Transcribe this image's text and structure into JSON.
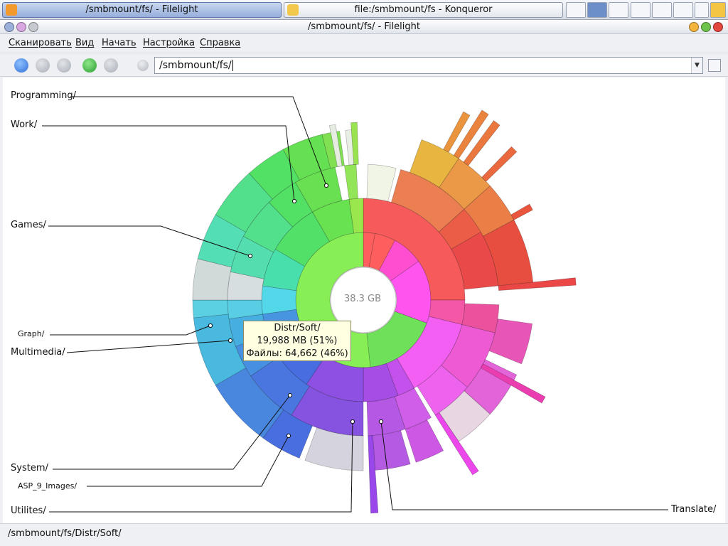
{
  "taskbar": {
    "tasks": [
      {
        "label": "/smbmount/fs/ - Filelight",
        "active": true
      },
      {
        "label": "file:/smbmount/fs - Konqueror",
        "active": false
      }
    ]
  },
  "window": {
    "title": "/smbmount/fs/ - Filelight"
  },
  "menu": {
    "items": [
      "Сканировать",
      "Вид",
      "Начать",
      "Настройка",
      "Справка"
    ]
  },
  "toolbar": {
    "location_value": "/smbmount/fs/"
  },
  "map": {
    "center_label": "38.3 GB",
    "labels": {
      "programming": "Programming/",
      "work": "Work/",
      "games": "Games/",
      "graph": "Graph/",
      "multimedia": "Multimedia/",
      "system": "System/",
      "asp": "ASP_9_Images/",
      "utilites": "Utilites/",
      "translate": "Translate/"
    },
    "tooltip": {
      "line1": "Distr/Soft/",
      "line2": "19,988 MB (51%)",
      "line3": "Файлы: 64,662 (46%)"
    }
  },
  "chart_data": {
    "type": "sunburst",
    "total": "38.3 GB",
    "segments": [
      {
        "name": "Distr/Soft/",
        "size_mb": 19988,
        "percent": 51,
        "files": 64662,
        "files_percent": 46,
        "color": "#88ee55"
      },
      {
        "name": "red-group",
        "color": "#ff5e5e"
      },
      {
        "name": "magenta-group",
        "color": "#ff55dd"
      },
      {
        "name": "purple-group",
        "color": "#9955ee"
      },
      {
        "name": "blue-group",
        "color": "#4a86e8"
      },
      {
        "name": "cyan-group",
        "color": "#55e0ea"
      }
    ]
  },
  "status": {
    "path": "/smbmount/fs/Distr/Soft/"
  }
}
